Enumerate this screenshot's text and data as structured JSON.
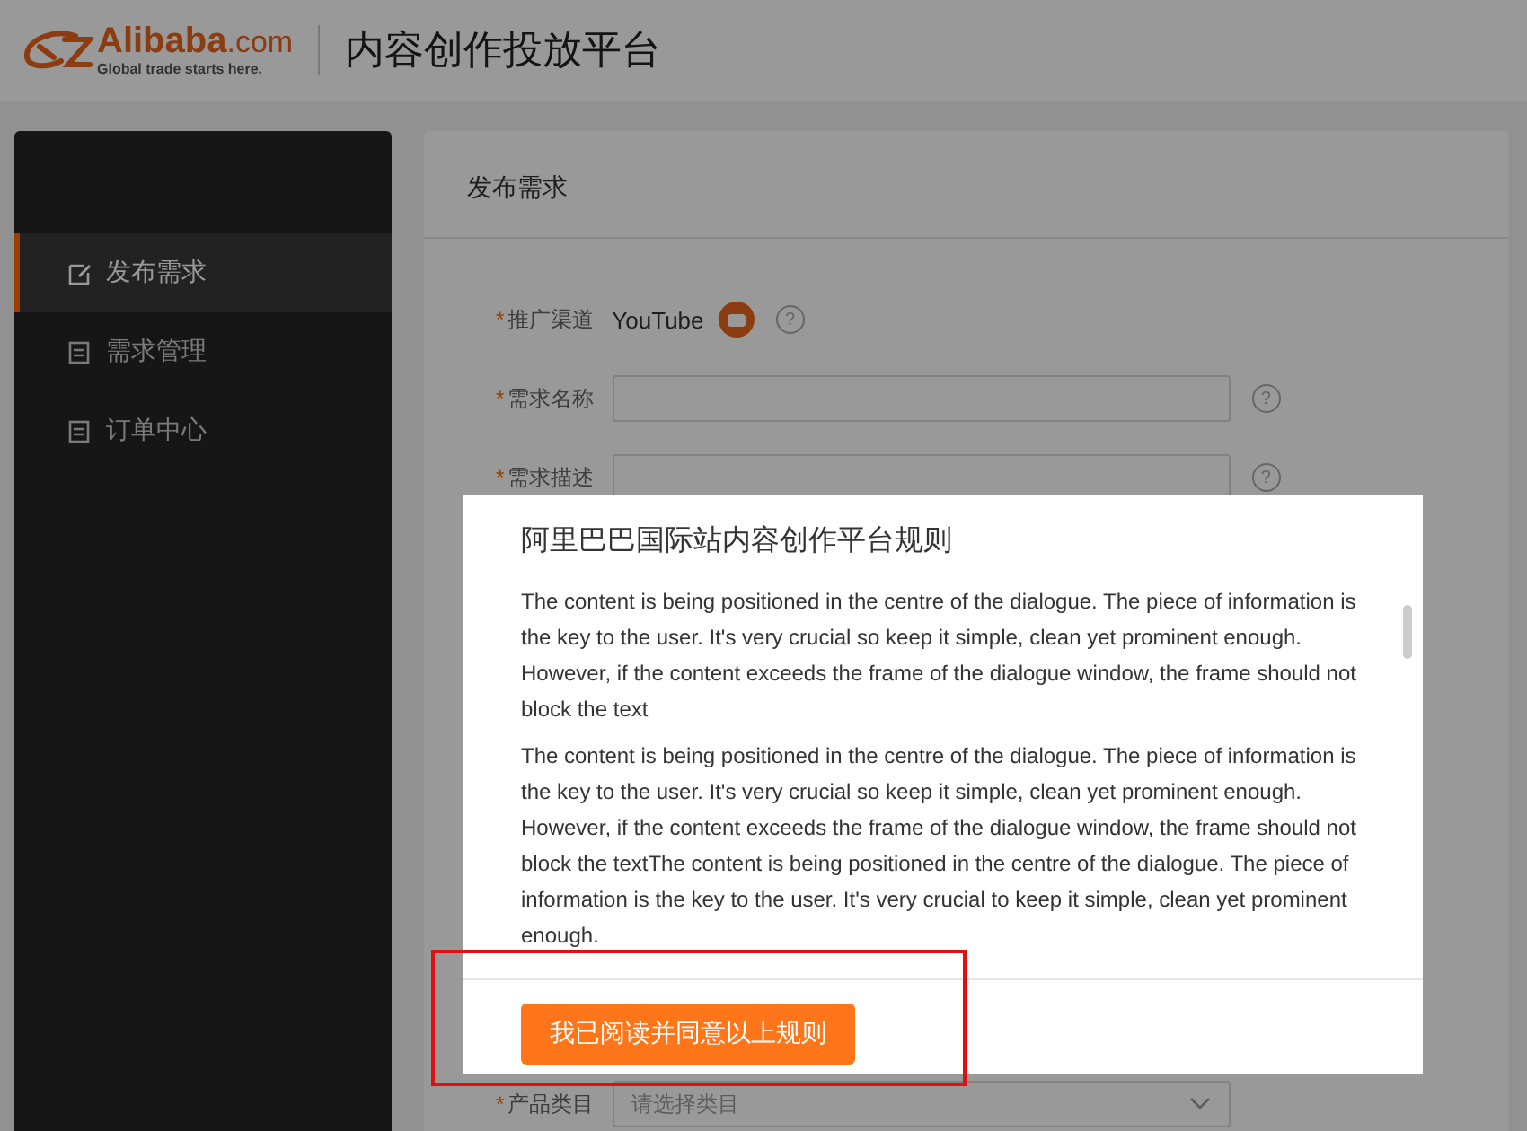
{
  "header": {
    "logo": {
      "brand": "Alibaba",
      "domain": ".com",
      "tagline": "Global trade starts here."
    },
    "title": "内容创作投放平台"
  },
  "sidebar": {
    "items": [
      {
        "label": "发布需求",
        "selected": true
      },
      {
        "label": "需求管理",
        "selected": false
      },
      {
        "label": "订单中心",
        "selected": false
      }
    ]
  },
  "main": {
    "title": "发布需求",
    "fields": [
      {
        "kind": "channel",
        "required": "*",
        "label": "推广渠道",
        "value": "YouTube",
        "help": "?"
      },
      {
        "kind": "text",
        "required": "*",
        "label": "需求名称",
        "help": "?"
      },
      {
        "kind": "text",
        "required": "*",
        "label": "需求描述",
        "help": "?"
      },
      {
        "kind": "select",
        "required": "*",
        "label": "产品类目",
        "placeholder": "请选择类目"
      }
    ]
  },
  "dialog": {
    "title": "阿里巴巴国际站内容创作平台规则",
    "paragraphs": [
      "The content is being positioned in the centre of the dialogue. The piece of information is the key to the user. It's very crucial so keep it simple, clean yet prominent enough. However, if the content exceeds the frame of the dialogue window, the frame should not block the text",
      "The content is being positioned in the centre of the dialogue. The piece of information is the key to the user. It's very crucial so keep it simple, clean yet prominent enough. However, if the content exceeds the frame of the dialogue window, the frame should not block the textThe content is being positioned in the centre of the dialogue. The piece of information is the key to the user. It's very crucial to keep it simple, clean yet prominent enough."
    ],
    "button": "我已阅读并同意以上规则"
  }
}
